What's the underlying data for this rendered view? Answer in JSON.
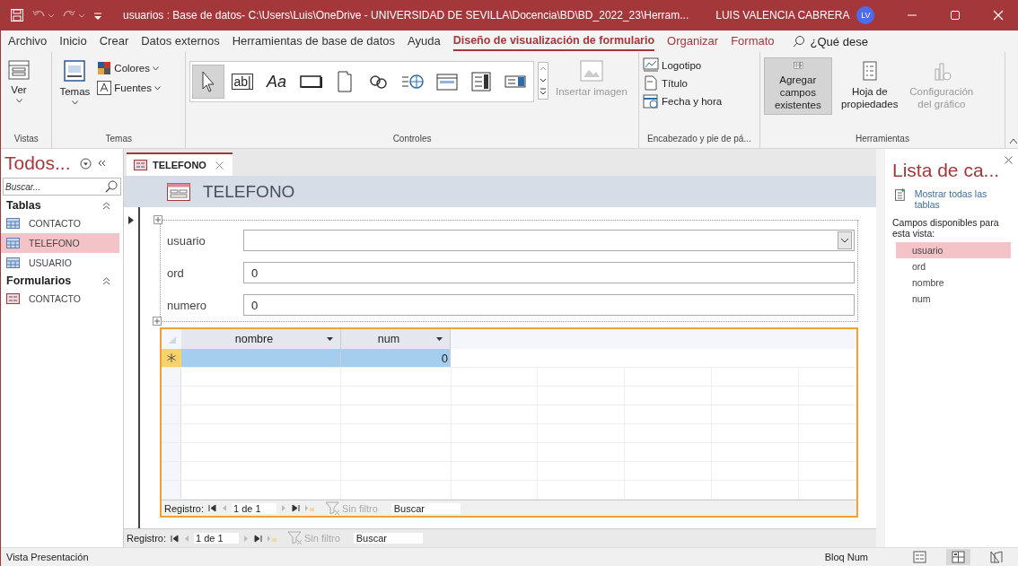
{
  "title_bar": {
    "title": "usuarios : Base de datos- C:\\Users\\Luis\\OneDrive - UNIVERSIDAD DE SEVILLA\\Docencia\\BD\\BD_2022_23\\Herram...",
    "user": "LUIS VALENCIA CABRERA",
    "initials": "LV"
  },
  "menu_tabs": [
    {
      "label": "Archivo",
      "selected": false,
      "kind": "standard"
    },
    {
      "label": "Inicio",
      "selected": false,
      "kind": "standard"
    },
    {
      "label": "Crear",
      "selected": false,
      "kind": "standard"
    },
    {
      "label": "Datos externos",
      "selected": false,
      "kind": "standard"
    },
    {
      "label": "Herramientas de base de datos",
      "selected": false,
      "kind": "standard"
    },
    {
      "label": "Ayuda",
      "selected": false,
      "kind": "standard"
    },
    {
      "label": "Diseño de visualización de formulario",
      "selected": true,
      "kind": "contextual"
    },
    {
      "label": "Organizar",
      "selected": false,
      "kind": "contextual"
    },
    {
      "label": "Formato",
      "selected": false,
      "kind": "contextual"
    }
  ],
  "tell_me": "¿Qué dese",
  "ribbon": {
    "vistas": {
      "button": "Ver",
      "label": "Vistas"
    },
    "temas": {
      "button": "Temas",
      "colores": "Colores",
      "fuentes": "Fuentes",
      "label": "Temas"
    },
    "controles": {
      "items": [
        {
          "kind": "pointer",
          "selected": true
        },
        {
          "kind": "textbox",
          "glyph": "ab|",
          "selected": false
        },
        {
          "kind": "label",
          "glyph": "Aa",
          "selected": false
        },
        {
          "kind": "button",
          "selected": false
        },
        {
          "kind": "tab",
          "selected": false
        },
        {
          "kind": "link",
          "selected": false
        },
        {
          "kind": "web",
          "selected": false
        },
        {
          "kind": "navigation",
          "selected": false
        },
        {
          "kind": "listbox",
          "selected": false
        },
        {
          "kind": "combo",
          "selected": false
        }
      ],
      "insert_image": {
        "label": "Insertar imagen",
        "disabled": true
      },
      "label": "Controles"
    },
    "encabezado": {
      "items": [
        {
          "kind": "logo",
          "label": "Logotipo"
        },
        {
          "kind": "title",
          "label": "Título"
        },
        {
          "kind": "datetime",
          "label": "Fecha y hora"
        }
      ],
      "label": "Encabezado y pie de pá..."
    },
    "herramientas": {
      "buttons": [
        {
          "kind": "fields",
          "label": "Agregar campos existentes",
          "selected": true,
          "disabled": false
        },
        {
          "kind": "sheet",
          "label": "Hoja de propiedades",
          "selected": false,
          "disabled": false
        },
        {
          "kind": "chart",
          "label": "Configuración del gráfico",
          "selected": false,
          "disabled": true
        }
      ],
      "label": "Herramientas"
    }
  },
  "nav_pane": {
    "title": "Todos...",
    "search_placeholder": "Buscar...",
    "groups": [
      {
        "label": "Tablas",
        "items": [
          {
            "label": "CONTACTO",
            "kind": "table",
            "selected": false
          },
          {
            "label": "TELEFONO",
            "kind": "table",
            "selected": true
          },
          {
            "label": "USUARIO",
            "kind": "table",
            "selected": false
          }
        ]
      },
      {
        "label": "Formularios",
        "items": [
          {
            "label": "CONTACTO",
            "kind": "form",
            "selected": false
          }
        ]
      }
    ]
  },
  "document": {
    "tab": "TELEFONO",
    "header": "TELEFONO",
    "fields": [
      {
        "label": "usuario",
        "kind": "combo"
      },
      {
        "label": "ord",
        "value": "0",
        "kind": "text"
      },
      {
        "label": "numero",
        "value": "0",
        "kind": "text"
      }
    ],
    "subform": {
      "columns": [
        {
          "label": "nombre"
        },
        {
          "label": "num",
          "new_row_value": "0"
        }
      ],
      "nav": {
        "label": "Registro:",
        "position": "1 de 1",
        "filter": "Sin filtro",
        "search": "Buscar"
      }
    },
    "nav": {
      "label": "Registro:",
      "position": "1 de 1",
      "filter": "Sin filtro",
      "search": "Buscar"
    }
  },
  "field_list": {
    "title": "Lista de ca...",
    "link": "Mostrar todas las tablas",
    "caption": "Campos disponibles para esta vista:",
    "fields": [
      {
        "label": "usuario",
        "selected": true
      },
      {
        "label": "ord",
        "selected": false
      },
      {
        "label": "nombre",
        "selected": false
      },
      {
        "label": "num",
        "selected": false
      }
    ]
  },
  "status_bar": {
    "text": "Vista Presentación",
    "num_lock": "Bloq Num",
    "views": [
      {
        "kind": "form",
        "selected": false
      },
      {
        "kind": "layout",
        "selected": true
      },
      {
        "kind": "design",
        "selected": false
      }
    ]
  }
}
